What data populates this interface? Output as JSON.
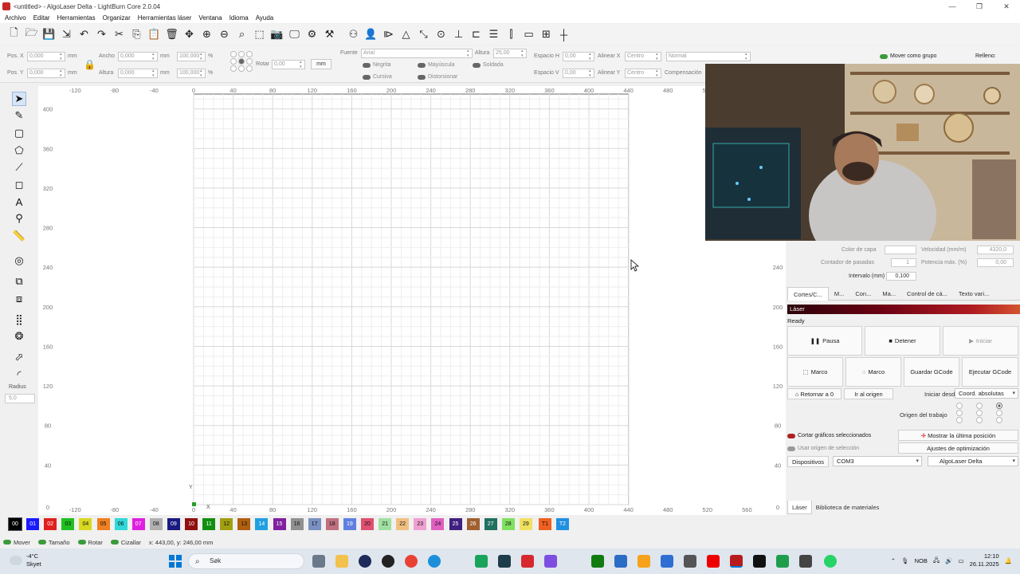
{
  "window": {
    "title": "<untitled> - AlgoLaser Delta - LightBurn Core 2.0.04",
    "controls": [
      "—",
      "❐",
      "✕"
    ]
  },
  "menu": [
    "Archivo",
    "Editar",
    "Herramientas",
    "Organizar",
    "Herramientas láser",
    "Ventana",
    "Idioma",
    "Ayuda"
  ],
  "toolbar_icons": [
    "new-file-icon",
    "open-folder-icon",
    "save-icon",
    "export-icon",
    "undo-icon",
    "redo-icon",
    "cut-icon",
    "copy-icon",
    "paste-icon",
    "delete-icon",
    "move-icon",
    "zoom-in-icon",
    "zoom-out-icon",
    "zoom-frame-icon",
    "zoom-select-icon",
    "camera-icon",
    "monitor-icon",
    "settings-gear-icon",
    "tools-icon",
    "group-icon",
    "user-icon",
    "flip-h-icon",
    "mirror-icon",
    "rotate-icon",
    "target-icon",
    "align-icon",
    "push-icon",
    "distribute-icon",
    "dock-icon",
    "align-vert-icon",
    "grid-icon"
  ],
  "props": {
    "pos_x_label": "Pos. X",
    "pos_x": "0,000",
    "pos_x_unit": "mm",
    "pos_y_label": "Pos. Y",
    "pos_y": "0,000",
    "pos_y_unit": "mm",
    "width_label": "Ancho",
    "width": "0,000",
    "width_unit": "mm",
    "width_pct": "100,000",
    "width_pct_unit": "%",
    "height_label": "Altura",
    "height": "0,000",
    "height_unit": "mm",
    "height_pct": "100,000",
    "height_pct_unit": "%",
    "rotate_label": "Rotar",
    "rotate": "0,00",
    "units_button": "mm",
    "font_label": "Fuente",
    "font": "Arial",
    "font_height_label": "Altura",
    "font_height": "25,00",
    "bold_label": "Negrita",
    "italic_label": "Cursiva",
    "upper_label": "Mayúscula",
    "distort_label": "Distorsionar",
    "weld_label": "Soldada",
    "hspace_label": "Espacio H",
    "hspace": "0,00",
    "vspace_label": "Espacio V",
    "vspace": "0,00",
    "align_x_label": "Alinear X",
    "align_x": "Centro",
    "align_y_label": "Alinear Y",
    "align_y": "Centro",
    "style": "Normal",
    "compensation_label": "Compensación",
    "move_group_label": "Mover como grupo",
    "fill_label": "Relleno:"
  },
  "left_tools": [
    "select-arrow-icon",
    "pen-icon",
    "rectangle-icon",
    "polygon-icon",
    "node-edit-icon",
    "shape-rect-icon",
    "text-tool-icon",
    "position-pin-icon",
    "measure-ruler-icon",
    "offset-icon",
    "boolean-union-icon",
    "boolean-sub-icon",
    "array-grid-icon",
    "circular-array-icon",
    "tab-icon",
    "corner-round-icon"
  ],
  "radius": {
    "label": "Radius",
    "value": "5,0"
  },
  "ruler": {
    "x_ticks": [
      "-120",
      "-80",
      "-40",
      "0",
      "40",
      "80",
      "120",
      "160",
      "200",
      "240",
      "280",
      "320",
      "360",
      "400",
      "440",
      "480",
      "520",
      "560"
    ],
    "y_ticks": [
      "400",
      "360",
      "320",
      "280",
      "240",
      "200",
      "160",
      "120",
      "80",
      "40",
      "0"
    ],
    "origin_x": "X",
    "origin_y": "Y"
  },
  "cut_settings": {
    "layer_color_label": "Color de capa",
    "speed_label": "Velocidad (mm/m)",
    "speed": "4320,0",
    "passes_label": "Contador de pasadas",
    "passes": "1",
    "power_label": "Potencia máx. (%)",
    "power": "0,00",
    "interval_label": "Intervalo (mm)",
    "interval": "0,100"
  },
  "panel_tabs": [
    "Cortes/C...",
    "M...",
    "Con...",
    "Ma...",
    "Control de cá...",
    "Texto vari..."
  ],
  "laser": {
    "header": "Láser",
    "status": "Ready",
    "pause": "Pausa",
    "stop": "Detener",
    "start": "Iniciar",
    "frame1": "Marco",
    "frame2": "Marco",
    "save_gcode": "Guardar GCode",
    "run_gcode": "Ejecutar GCode",
    "home": "Retornar a 0",
    "go_origin": "Ir al origen",
    "start_from_label": "Iniciar desde:",
    "start_from": "Coord. absolutas",
    "job_origin_label": "Origen del trabajo",
    "cut_selected_label": "Cortar gráficos seleccionados",
    "use_selection_origin_label": "Usar origen de selección",
    "show_last_label": "Mostrar la última posición",
    "optimization_label": "Ajustes de optimización",
    "devices_label": "Dispositivos",
    "port": "COM3",
    "device": "AlgoLaser Delta"
  },
  "bottom_tabs": [
    "Láser",
    "Biblioteca de materiales"
  ],
  "palette": [
    {
      "label": "00",
      "color": "#000000",
      "text": "#ffffff"
    },
    {
      "label": "01",
      "color": "#1a1aff",
      "text": "#ffffff"
    },
    {
      "label": "02",
      "color": "#e02020",
      "text": "#ffffff"
    },
    {
      "label": "03",
      "color": "#20c020",
      "text": "#111111"
    },
    {
      "label": "04",
      "color": "#d8d820",
      "text": "#111111"
    },
    {
      "label": "05",
      "color": "#f08020",
      "text": "#111111"
    },
    {
      "label": "06",
      "color": "#30d8d8",
      "text": "#111111"
    },
    {
      "label": "07",
      "color": "#e020e0",
      "text": "#ffffff"
    },
    {
      "label": "08",
      "color": "#b0b0b0",
      "text": "#111111"
    },
    {
      "label": "09",
      "color": "#1a1a80",
      "text": "#ffffff"
    },
    {
      "label": "10",
      "color": "#901010",
      "text": "#ffffff"
    },
    {
      "label": "11",
      "color": "#109010",
      "text": "#ffffff"
    },
    {
      "label": "12",
      "color": "#a0a010",
      "text": "#111111"
    },
    {
      "label": "13",
      "color": "#b06010",
      "text": "#111111"
    },
    {
      "label": "14",
      "color": "#20a0e0",
      "text": "#ffffff"
    },
    {
      "label": "15",
      "color": "#8020a0",
      "text": "#ffffff"
    },
    {
      "label": "16",
      "color": "#909090",
      "text": "#111111"
    },
    {
      "label": "17",
      "color": "#7a90c0",
      "text": "#111111"
    },
    {
      "label": "18",
      "color": "#c07080",
      "text": "#111111"
    },
    {
      "label": "19",
      "color": "#6080e0",
      "text": "#ffffff"
    },
    {
      "label": "20",
      "color": "#e05070",
      "text": "#111111"
    },
    {
      "label": "21",
      "color": "#a0e0a0",
      "text": "#111111"
    },
    {
      "label": "22",
      "color": "#f0c080",
      "text": "#111111"
    },
    {
      "label": "23",
      "color": "#f0a0d0",
      "text": "#111111"
    },
    {
      "label": "24",
      "color": "#e060c0",
      "text": "#111111"
    },
    {
      "label": "25",
      "color": "#402080",
      "text": "#ffffff"
    },
    {
      "label": "26",
      "color": "#a06030",
      "text": "#ffffff"
    },
    {
      "label": "27",
      "color": "#207060",
      "text": "#ffffff"
    },
    {
      "label": "28",
      "color": "#80e060",
      "text": "#111111"
    },
    {
      "label": "29",
      "color": "#f0e060",
      "text": "#111111"
    },
    {
      "label": "T1",
      "color": "#f06020",
      "text": "#111111"
    },
    {
      "label": "T2",
      "color": "#2090e0",
      "text": "#ffffff"
    }
  ],
  "statusbar": {
    "move": "Mover",
    "size": "Tamaño",
    "rotate": "Rotar",
    "shear": "Cizallar",
    "coords": "x: 443,00, y: 246,00 mm"
  },
  "taskbar": {
    "temp": "-4°C",
    "weather": "Skyet",
    "search": "Søk",
    "lang": "NOB",
    "time": "12:10",
    "date": "26.11.2025"
  }
}
